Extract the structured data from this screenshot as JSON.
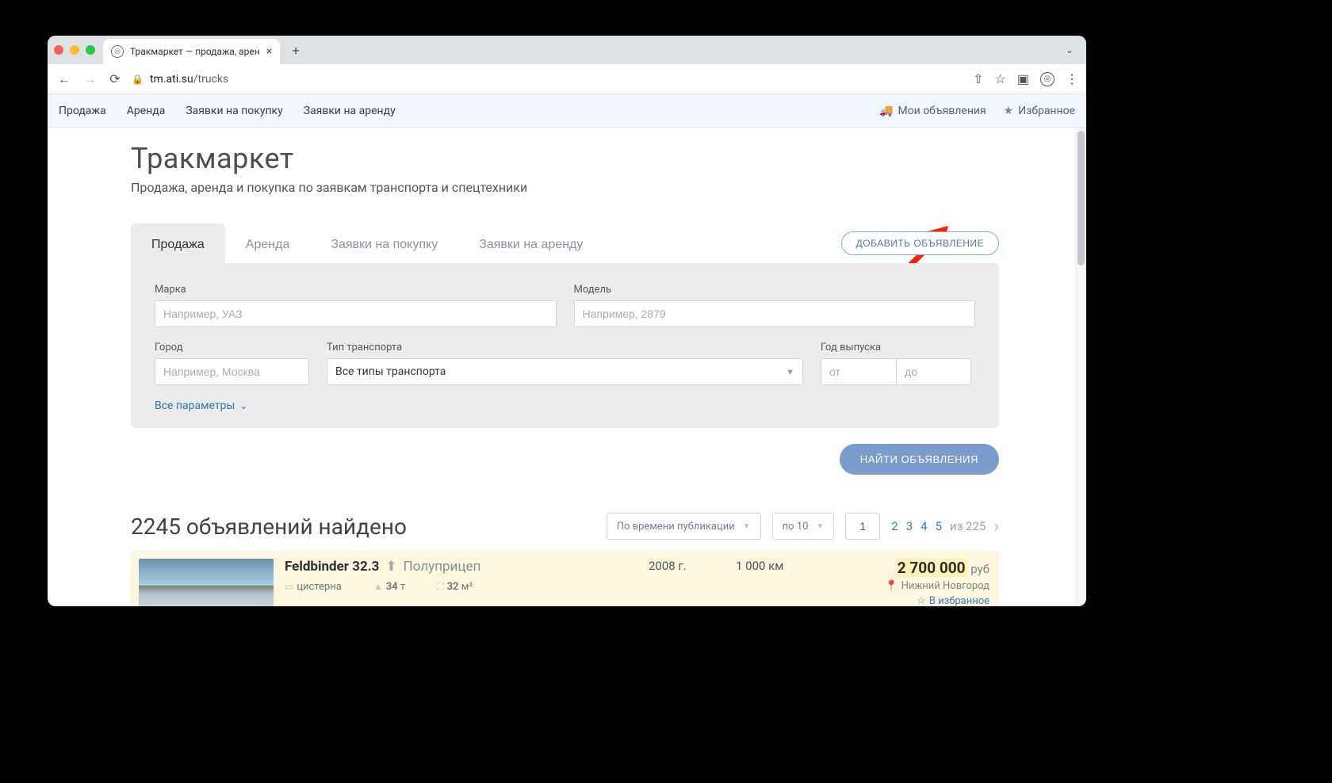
{
  "browser": {
    "tab_title": "Тракмаркет — продажа, арен",
    "url_host": "tm.ati.su",
    "url_path": "/trucks"
  },
  "sitenav": {
    "items": [
      "Продажа",
      "Аренда",
      "Заявки на покупку",
      "Заявки на аренду"
    ],
    "my_ads": "Мои объявления",
    "favorites": "Избранное"
  },
  "hero": {
    "title": "Тракмаркет",
    "subtitle": "Продажа, аренда и покупка по заявкам транспорта и спецтехники"
  },
  "tabs": [
    "Продажа",
    "Аренда",
    "Заявки на покупку",
    "Заявки на аренду"
  ],
  "add_btn": "ДОБАВИТЬ ОБЪЯВЛЕНИЕ",
  "filters": {
    "brand_label": "Марка",
    "brand_ph": "Например, УАЗ",
    "model_label": "Модель",
    "model_ph": "Например, 2879",
    "city_label": "Город",
    "city_ph": "Например, Москва",
    "type_label": "Тип транспорта",
    "type_value": "Все типы транспорта",
    "year_label": "Год выпуска",
    "year_from_ph": "от",
    "year_to_ph": "до",
    "all_params": "Все параметры"
  },
  "find_btn": "НАЙТИ ОБЪЯВЛЕНИЯ",
  "results": {
    "count_label": "2245 объявлений найдено",
    "sort_value": "По времени публикации",
    "perpage_value": "по 10",
    "page_input": "1",
    "pages": [
      "2",
      "3",
      "4",
      "5"
    ],
    "of_label": "из 225"
  },
  "listing": {
    "name": "Feldbinder 32.3",
    "category": "Полуприцеп",
    "spec_body": "цистерна",
    "spec_weight": "34",
    "spec_weight_unit": "т",
    "spec_volume": "32",
    "spec_volume_unit": "м³",
    "year": "2008 г.",
    "mileage": "1 000 км",
    "price": "2 700 000",
    "currency": "руб",
    "location": "Нижний Новгород",
    "fav_label": "В избранное"
  }
}
